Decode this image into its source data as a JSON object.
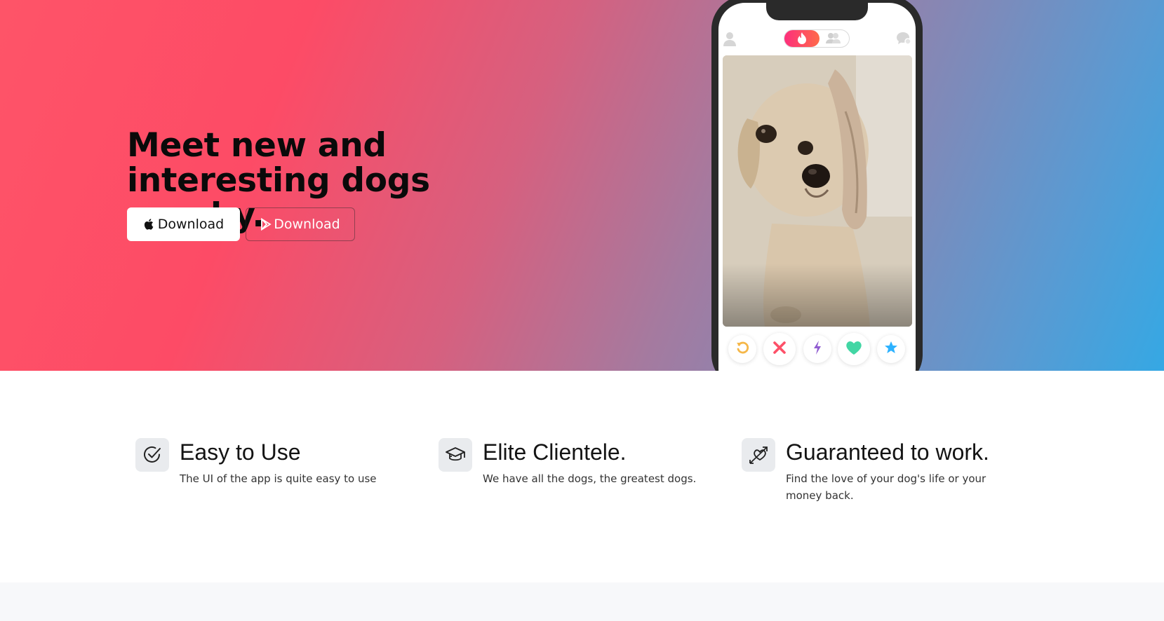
{
  "hero": {
    "title": "Meet new and interesting dogs nearby.",
    "apple_button": "Download",
    "play_button": "Download"
  },
  "phone": {
    "top_icons": [
      "profile-icon",
      "flame-icon",
      "group-icon",
      "chat-icon"
    ],
    "actions": [
      "rewind-icon",
      "nope-icon",
      "boost-icon",
      "like-icon",
      "super-like-icon"
    ],
    "colors": {
      "rewind": "#f5b748",
      "nope": "#fd5068",
      "boost": "#915dd1",
      "like": "#42d6a4",
      "super_like": "#2db2ff"
    }
  },
  "features": [
    {
      "icon": "check-circle-icon",
      "title": "Easy to Use",
      "text": "The UI of the app is quite easy to use"
    },
    {
      "icon": "graduation-cap-icon",
      "title": "Elite Clientele.",
      "text": "We have all the dogs, the greatest dogs."
    },
    {
      "icon": "heart-arrow-icon",
      "title": "Guaranteed to work.",
      "text": "Find the love of your dog's life or your money back."
    }
  ]
}
